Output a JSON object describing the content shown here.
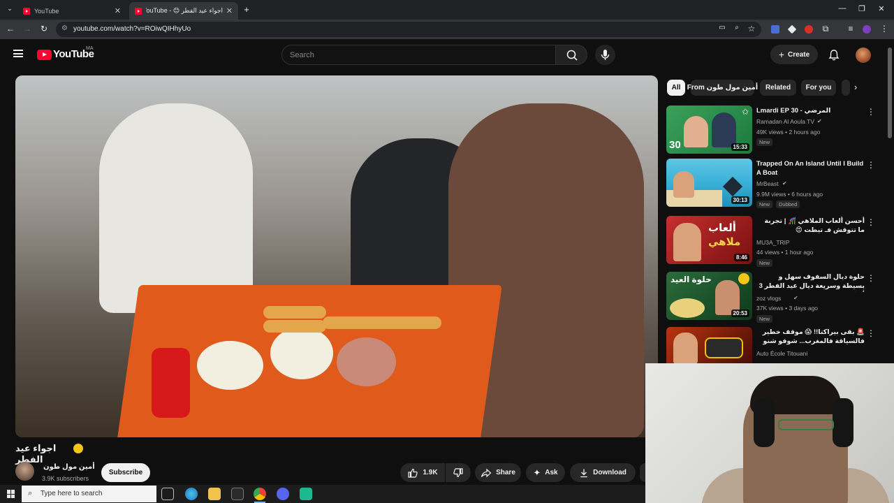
{
  "browser": {
    "tabs": [
      {
        "label": "YouTube",
        "active": false
      },
      {
        "label": "اجواء عيد الفطر 😊 - YouTube",
        "active": true
      }
    ],
    "url": "youtube.com/watch?v=ROiwQIHhyUo",
    "new_tab": "+",
    "window_controls": [
      "—",
      "❐",
      "✕"
    ]
  },
  "header": {
    "logo": "YouTube",
    "country": "MA",
    "search_placeholder": "Search",
    "create_label": "Create"
  },
  "video": {
    "title": "اجواء عيد الفطر",
    "title_emoji": "😊"
  },
  "channel": {
    "name": "أمين مول طون",
    "subscribers": "3.9K subscribers",
    "subscribe_label": "Subscribe"
  },
  "actions": {
    "likes": "1.9K",
    "share": "Share",
    "ask": "Ask",
    "download": "Download"
  },
  "chips": [
    "All",
    "From أمين مول طون",
    "Related",
    "For you"
  ],
  "recommendations": [
    {
      "title": "Lmardi EP 30 - المرضي",
      "channel": "Ramadan Al Aoula TV",
      "meta": "49K views • 2 hours ago",
      "badge": "New",
      "duration": "15:33",
      "verified": true
    },
    {
      "title": "Trapped On An Island Until I Build A Boat",
      "channel": "MrBeast",
      "meta": "9.9M views • 6 hours ago",
      "badge": "New",
      "badge2": "Dubbed",
      "duration": "30:13",
      "verified": true
    },
    {
      "title": "أحسن ألعاب الملاهي 🎢 | تجربة ما تتوقش فـ تيطت 😍",
      "channel": "MU3A_TRIP",
      "meta": "44 views • 1 hour ago",
      "badge": "New",
      "duration": "8:46",
      "verified": false
    },
    {
      "title": "حلوة ديال السفوف سهل و بسيطة وسريعة ديال عيد الفطر 3 أشكال",
      "channel": "zoz vlogs",
      "meta": "37K views • 3 days ago",
      "badge": "New",
      "duration": "20:53",
      "verified": true
    },
    {
      "title": "🚨 بقى بيراكتا!! 😱 موقف خطير فالسياقة فالمغرب... شوفو شنو وقع",
      "channel": "Auto École Titouani",
      "meta": "",
      "badge": "",
      "duration": "",
      "verified": false
    }
  ],
  "taskbar": {
    "search_placeholder": "Type here to search"
  },
  "colors": {
    "bg": "#0f0f0f",
    "accent": "#ff0033"
  }
}
